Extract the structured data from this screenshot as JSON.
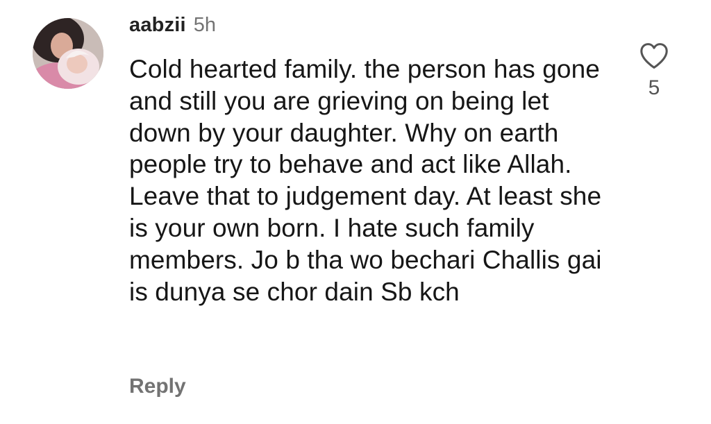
{
  "comment": {
    "username": "aabzii",
    "timestamp": "5h",
    "text": "Cold hearted family. the person has gone and still you are grieving on being let down by your daughter. Why on earth people try to behave and act like Allah. Leave that to judgement day. At least she is your own born. I hate such family members. Jo b tha wo bechari Challis gai is dunya se chor dain Sb kch",
    "reply_label": "Reply",
    "like_count": "5",
    "avatar_icon": "profile-photo",
    "like_icon": "heart-outline-icon"
  },
  "colors": {
    "text": "#161616",
    "muted": "#737373",
    "background": "#ffffff"
  }
}
